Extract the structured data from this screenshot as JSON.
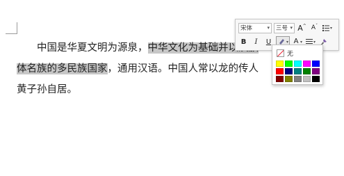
{
  "document": {
    "line1": {
      "plain": "　　中国是华夏文明为源泉，",
      "highlight": "中华文化为基础并以汉族"
    },
    "line2": {
      "highlight": "体名族的多民族国家",
      "plain": "，通用汉语。中国人常以龙的传人"
    },
    "line3": {
      "plain": "黄子孙自居。"
    }
  },
  "toolbar": {
    "font_name": "宋体",
    "font_size": "三号",
    "grow_font_label": "A",
    "shrink_font_label": "A",
    "bold_label": "B",
    "italic_label": "I",
    "underline_label": "U",
    "font_color_label": "A",
    "highlight_color": "#f0e000",
    "font_color": "#e02020"
  },
  "highlight_palette": {
    "no_color_label": "无",
    "colors": [
      "#ffff00",
      "#00ff00",
      "#00ffff",
      "#ff00ff",
      "#0000ff",
      "#ff0000",
      "#000080",
      "#008080",
      "#008000",
      "#800080",
      "#800000",
      "#808000",
      "#808080",
      "#c0c0c0",
      "#000000"
    ]
  }
}
